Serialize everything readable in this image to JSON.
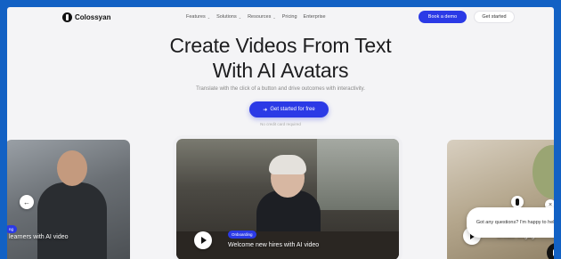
{
  "nav": {
    "brand": "Colossyan",
    "links": [
      {
        "label": "Features",
        "dropdown": true
      },
      {
        "label": "Solutions",
        "dropdown": true
      },
      {
        "label": "Resources",
        "dropdown": true
      },
      {
        "label": "Pricing",
        "dropdown": false
      },
      {
        "label": "Enterprise",
        "dropdown": false
      }
    ],
    "demo_label": "Book a demo",
    "started_label": "Get started"
  },
  "hero": {
    "title_line1": "Create Videos From Text",
    "title_line2": "With AI Avatars",
    "subtitle": "Translate with the click of a button and drive outcomes with interactivity.",
    "cta_label": "Get started for free",
    "note": "No credit card required"
  },
  "cards": [
    {
      "badge": "ng",
      "caption": "learners with AI video"
    },
    {
      "badge": "Onboarding",
      "caption": "Welcome new hires with AI video"
    },
    {
      "caption": "Create engag"
    }
  ],
  "chat": {
    "message": "Got any questions? I'm happy to help."
  },
  "colors": {
    "accent": "#2b3ae6",
    "border": "#1261c4"
  }
}
